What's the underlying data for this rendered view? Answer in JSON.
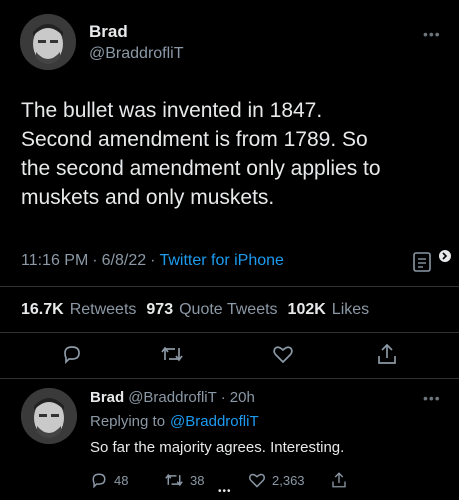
{
  "main_tweet": {
    "author_name": "Brad",
    "author_handle": "@BraddrofliT",
    "text_lines": [
      "The bullet was invented in 1847.",
      "Second amendment is from 1789. So",
      "the second amendment only applies to",
      "muskets and only muskets."
    ],
    "time": "11:16 PM",
    "date": "6/8/22",
    "separator": "·",
    "source": "Twitter for iPhone",
    "retweets_count": "16.7K",
    "retweets_label": "Retweets",
    "quotes_count": "973",
    "quotes_label": "Quote Tweets",
    "likes_count": "102K",
    "likes_label": "Likes"
  },
  "reply_tweet": {
    "author_name": "Brad",
    "author_handle": "@BraddrofliT",
    "time_ago": "20h",
    "replying_prefix": "Replying to",
    "replying_handle": "@BraddrofliT",
    "text": "So far the majority agrees. Interesting.",
    "reply_count": "48",
    "retweet_count": "38",
    "like_count": "2,363"
  },
  "colors": {
    "background": "#000000",
    "text": "#e7e9ea",
    "muted": "#8b98a5",
    "accent": "#1d9bf0",
    "divider": "#2f3336"
  },
  "icons": [
    "more-icon",
    "reply-icon",
    "retweet-icon",
    "like-icon",
    "share-icon",
    "analytics-icon"
  ]
}
